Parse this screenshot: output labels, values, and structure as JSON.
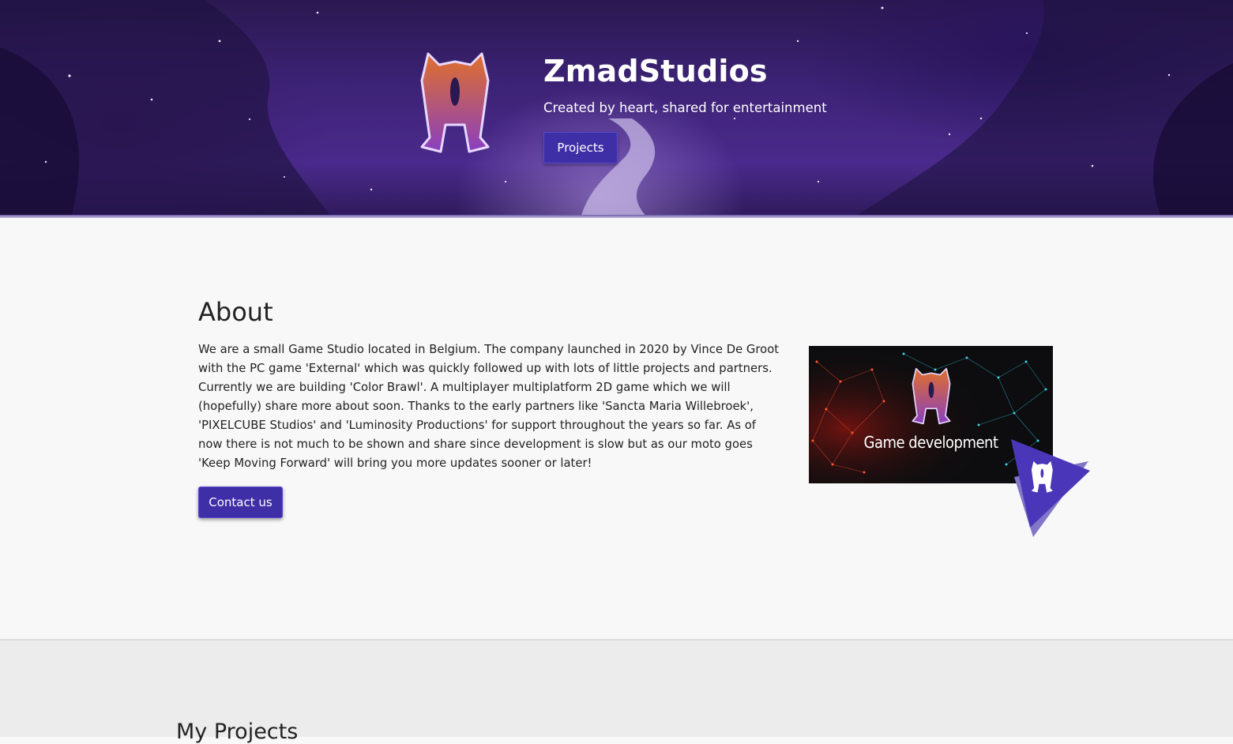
{
  "hero": {
    "title": "ZmadStudios",
    "subtitle": "Created by heart, shared for entertainment",
    "projects_button": "Projects"
  },
  "about": {
    "heading": "About",
    "text": "We are a small Game Studio located in Belgium. The company launched in 2020 by Vince De Groot with the PC game 'External' which was quickly followed up with lots of little projects and partners. Currently we are building 'Color Brawl'. A multiplayer multiplatform 2D game which we will (hopefully) share more about soon. Thanks to the early partners like 'Sancta Maria Willebroek', 'PIXELCUBE Studios' and 'Luminosity Productions' for support throughout the years so far. As of now there is not much to be shown and share since development is slow but as our moto goes 'Keep Moving Forward' will bring you more updates sooner or later!",
    "contact_button": "Contact us",
    "image_caption": "Game development"
  },
  "projects": {
    "heading": "My Projects"
  },
  "colors": {
    "accent": "#3f2fa6",
    "hero_background": "#3d2377",
    "logo_gradient_top": "#e0702a",
    "logo_gradient_bottom": "#8a3fc0",
    "badge": "#4a36b8"
  },
  "icons": {
    "hero_logo": "studio-logo-icon",
    "image_logo": "studio-logo-icon",
    "badge": "play-triangle-icon"
  }
}
